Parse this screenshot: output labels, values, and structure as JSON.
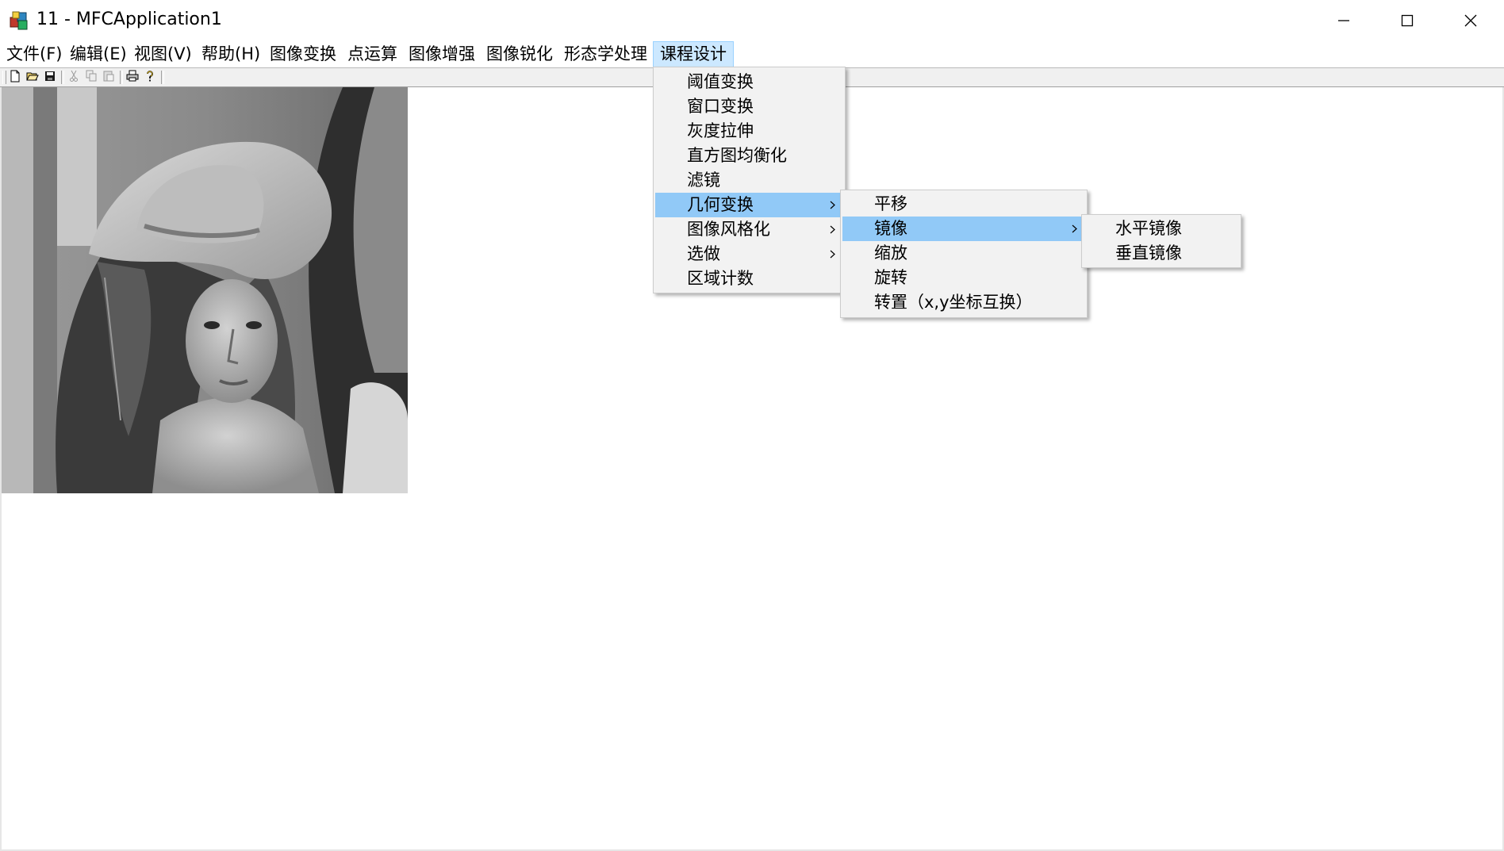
{
  "window": {
    "title": "11 - MFCApplication1",
    "icon": "mfc-app-icon",
    "controls": [
      "minimize-icon",
      "maximize-icon",
      "close-icon"
    ]
  },
  "menubar": {
    "items": [
      {
        "label": "文件(F)",
        "name": "menu-file"
      },
      {
        "label": "编辑(E)",
        "name": "menu-edit"
      },
      {
        "label": "视图(V)",
        "name": "menu-view"
      },
      {
        "label": "帮助(H)",
        "name": "menu-help"
      },
      {
        "label": "图像变换",
        "name": "menu-image-transform"
      },
      {
        "label": "点运算",
        "name": "menu-point-operation"
      },
      {
        "label": "图像增强",
        "name": "menu-image-enhance"
      },
      {
        "label": "图像锐化",
        "name": "menu-image-sharpen"
      },
      {
        "label": "形态学处理",
        "name": "menu-morphology"
      },
      {
        "label": "课程设计",
        "name": "menu-course-design",
        "active": true
      }
    ]
  },
  "toolbar": {
    "buttons": [
      "new-file-icon",
      "open-folder-icon",
      "save-disk-icon",
      "cut-icon",
      "copy-icon",
      "paste-icon",
      "print-icon",
      "help-icon"
    ]
  },
  "dropdown_course_design": {
    "items": [
      {
        "label": "阈值变换",
        "submenu": false
      },
      {
        "label": "窗口变换",
        "submenu": false
      },
      {
        "label": "灰度拉伸",
        "submenu": false
      },
      {
        "label": "直方图均衡化",
        "submenu": false
      },
      {
        "label": "滤镜",
        "submenu": false
      },
      {
        "label": "几何变换",
        "submenu": true,
        "highlighted": true
      },
      {
        "label": "图像风格化",
        "submenu": true
      },
      {
        "label": "选做",
        "submenu": true
      },
      {
        "label": "区域计数",
        "submenu": false
      }
    ]
  },
  "submenu_geometric": {
    "items": [
      {
        "label": "平移",
        "submenu": false
      },
      {
        "label": "镜像",
        "submenu": true,
        "highlighted": true
      },
      {
        "label": "缩放",
        "submenu": false
      },
      {
        "label": "旋转",
        "submenu": false
      },
      {
        "label": "转置（x,y坐标互换）",
        "submenu": false
      }
    ]
  },
  "submenu_mirror": {
    "items": [
      {
        "label": "水平镜像"
      },
      {
        "label": "垂直镜像"
      }
    ]
  },
  "colors": {
    "menu_highlight": "#91c9f7",
    "menubar_active": "#cce8ff",
    "dropdown_bg": "#f2f2f2",
    "toolbar_bg": "#f0f0f0"
  }
}
